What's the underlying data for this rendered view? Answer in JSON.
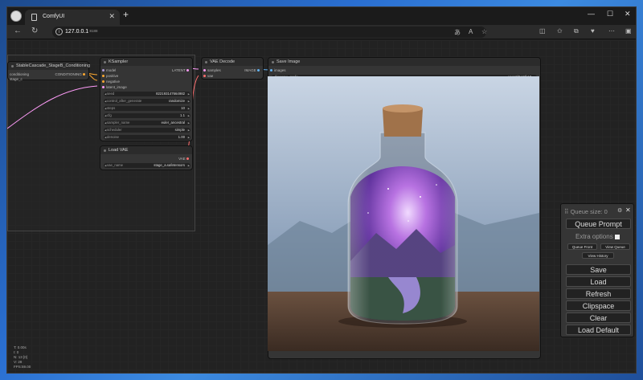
{
  "browser": {
    "tab_title": "ComfyUI",
    "url_host": "127.0.0.1",
    "url_port": ":8188"
  },
  "group": {
    "title": "StableCascade_StageB_Conditioning"
  },
  "cond_node": {
    "in1": "conditioning",
    "in2": "stage_c",
    "out": "CONDITIONING"
  },
  "ksampler": {
    "title": "KSampler",
    "inputs": [
      "model",
      "positive",
      "negative",
      "latent_image"
    ],
    "output": "LATENT",
    "widgets": [
      {
        "label": "seed",
        "value": "822193147664982"
      },
      {
        "label": "control_after_generate",
        "value": "randomize"
      },
      {
        "label": "steps",
        "value": "10"
      },
      {
        "label": "cfg",
        "value": "1.1"
      },
      {
        "label": "sampler_name",
        "value": "euler_ancestral"
      },
      {
        "label": "scheduler",
        "value": "simple"
      },
      {
        "label": "denoise",
        "value": "1.00"
      }
    ]
  },
  "load_vae": {
    "title": "Load VAE",
    "output": "VAE",
    "widget_label": "vae_name",
    "widget_value": "stage_a.safetensors"
  },
  "vae_decode": {
    "title": "VAE Decode",
    "in1": "samples",
    "in2": "vae",
    "output": "IMAGE"
  },
  "save_image": {
    "title": "Save Image",
    "input": "images",
    "widget_label": "filename_prefix",
    "widget_value": "wuerr/ComfyUI"
  },
  "stats": [
    "T: 0.00s",
    "I: 0",
    "N: 13 [0]",
    "V: 28",
    "FPS:59.00"
  ],
  "menu": {
    "queue_size": "Queue size: 0",
    "queue_prompt": "Queue Prompt",
    "extra_options": "Extra options",
    "queue_front": "Queue Front",
    "view_queue": "View Queue",
    "view_history": "View History",
    "save": "Save",
    "load": "Load",
    "refresh": "Refresh",
    "clipspace": "Clipspace",
    "clear": "Clear",
    "load_default": "Load Default"
  },
  "colors": {
    "model_port": "#b39ddb",
    "cond_port": "#ffa931",
    "latent_port": "#ff9cf9",
    "vae_port": "#ff6e6e",
    "image_port": "#64b5f6"
  }
}
